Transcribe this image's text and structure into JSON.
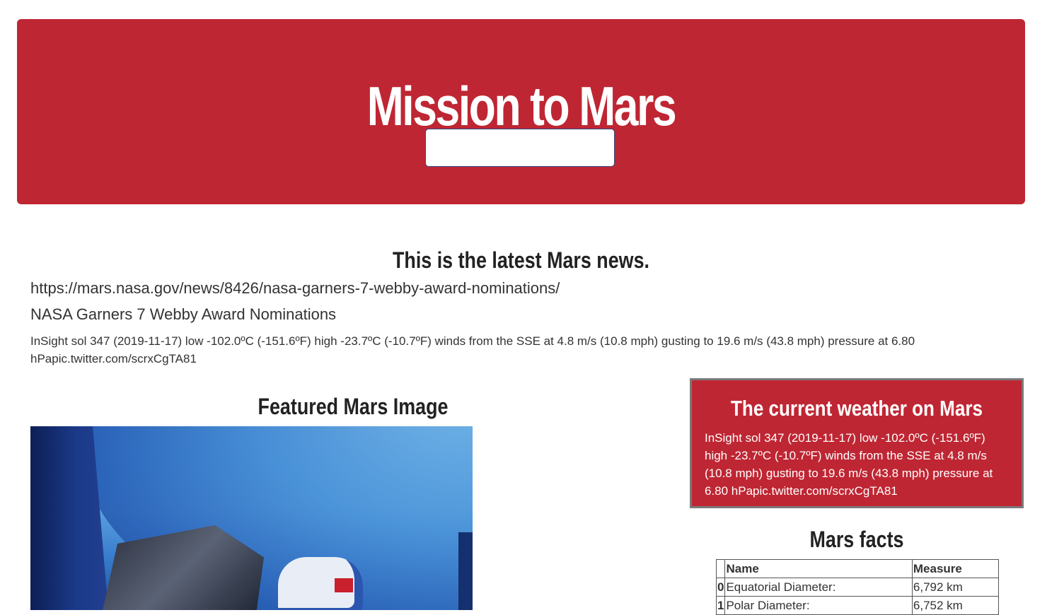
{
  "header": {
    "title": "Mission to Mars",
    "scrape_button_label": ""
  },
  "news": {
    "heading": "This is the latest Mars news.",
    "url": "https://mars.nasa.gov/news/8426/nasa-garners-7-webby-award-nominations/",
    "title": "NASA Garners 7 Webby Award Nominations",
    "paragraph": "InSight sol 347 (2019-11-17) low -102.0ºC (-151.6ºF) high -23.7ºC (-10.7ºF) winds from the SSE at 4.8 m/s (10.8 mph) gusting to 19.6 m/s (43.8 mph) pressure at 6.80 hPapic.twitter.com/scrxCgTA81"
  },
  "featured": {
    "heading": "Featured Mars Image"
  },
  "weather": {
    "heading": "The current weather on Mars",
    "text": "InSight sol 347 (2019-11-17) low -102.0ºC (-151.6ºF) high -23.7ºC (-10.7ºF) winds from the SSE at 4.8 m/s (10.8 mph) gusting to 19.6 m/s (43.8 mph) pressure at 6.80 hPapic.twitter.com/scrxCgTA81"
  },
  "facts": {
    "heading": "Mars facts",
    "columns": [
      "",
      "Name",
      "Measure"
    ],
    "rows": [
      {
        "index": "0",
        "name": "Equatorial Diameter:",
        "measure": "6,792 km"
      },
      {
        "index": "1",
        "name": "Polar Diameter:",
        "measure": "6,752 km"
      }
    ]
  },
  "colors": {
    "accent": "#bf2633",
    "background": "#ffffff",
    "text": "#333333"
  }
}
